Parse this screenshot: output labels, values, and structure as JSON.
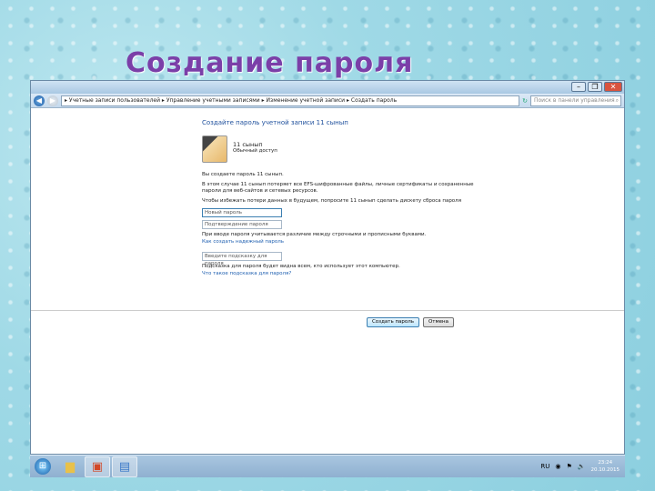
{
  "slide": {
    "title": "Создание пароля"
  },
  "window": {
    "address": {
      "breadcrumb": [
        "Учетные записи пользователей",
        "Управление учетными записями",
        "Изменение учетной записи",
        "Создать пароль"
      ],
      "search_placeholder": "Поиск в панели управления"
    },
    "heading": "Создайте пароль учетной записи 11 сынып",
    "user": {
      "name": "11 сынып",
      "role": "Обычный доступ"
    },
    "text1": "Вы создаете пароль 11 сынып.",
    "text2": "В этом случае 11 сынып потеряет все EFS-шифрованные файлы, личные сертификаты и сохраненные пароли для веб-сайтов и сетевых ресурсов.",
    "text3": "Чтобы избежать потери данных в будущем, попросите 11 сынып сделать дискету сброса пароля",
    "new_password_placeholder": "Новый пароль",
    "confirm_placeholder": "Подтверждение пароля",
    "case_note": "При вводе пароля учитывается различие между строчными и прописными буквами.",
    "strong_link": "Как создать надежный пароль",
    "hint_placeholder": "Введите подсказку для пароля",
    "hint_note": "Подсказка для пароля будет видна всем, кто использует этот компьютер.",
    "hint_link": "Что такое подсказка для пароля?",
    "create_button": "Создать пароль",
    "cancel_button": "Отмена"
  },
  "taskbar": {
    "lang": "RU",
    "time": "23:24",
    "date": "20.10.2015"
  }
}
